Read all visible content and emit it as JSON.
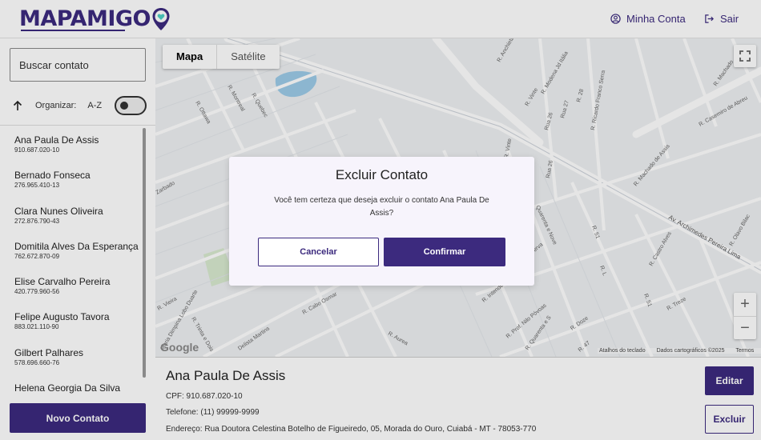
{
  "header": {
    "logo_text": "MAPAMIGO",
    "account_label": "Minha Conta",
    "logout_label": "Sair"
  },
  "sidebar": {
    "search_placeholder": "Buscar contato",
    "sort_label": "Organizar:",
    "sort_value": "A-Z",
    "contacts": [
      {
        "name": "Ana Paula De Assis",
        "cpf": "910.687.020-10"
      },
      {
        "name": "Bernado Fonseca",
        "cpf": "276.965.410-13"
      },
      {
        "name": "Clara Nunes Oliveira",
        "cpf": "272.876.790-43"
      },
      {
        "name": "Domitila Alves Da Esperança",
        "cpf": "762.672.870-09"
      },
      {
        "name": "Elise Carvalho Pereira",
        "cpf": "420.779.960-56"
      },
      {
        "name": "Felipe Augusto Tavora",
        "cpf": "883.021.110-90"
      },
      {
        "name": "Gilbert Palhares",
        "cpf": "578.696.660-76"
      },
      {
        "name": "Helena Georgia Da Silva",
        "cpf": ""
      }
    ],
    "new_contact_label": "Novo Contato"
  },
  "map": {
    "type_map": "Mapa",
    "type_satellite": "Satélite",
    "google": "Google",
    "attrib_shortcuts": "Atalhos do teclado",
    "attrib_data": "Dados cartográficos ©2025",
    "attrib_terms": "Termos",
    "zoom_in": "+",
    "zoom_out": "−",
    "street_labels": [
      "R. Anchieta",
      "R. Modena Jd Itália",
      "R. Ricardo Franco Serra",
      "R. Machado",
      "R. Montreal",
      "R. Quebec",
      "R. Ottawa",
      "R. Vinte",
      "Rua 26",
      "Rua 27",
      "R. 28",
      "R. Casemiro de Abreu",
      "R. Machado de Assis",
      "Av. Archimedes Pereira Lima",
      "R. Olavo Bilac",
      "R. Castro Alves",
      "R. Treze",
      "R. Vinte",
      "Rua 26",
      "R. 51",
      "Quarenta e Nove",
      "Serva",
      "R. L",
      "R. 51",
      "R. Intendente",
      "R. Prof. Nilo Póvoas",
      "R. Quarenta e S",
      "R. Doze",
      "R. 47",
      "R. Vieira",
      "Maria Dimpina Lobo Duarte",
      "R. Trinta e Dois",
      "R. Cabo Osmar",
      "Delista Martins",
      "R. Aurea",
      "Zarbado"
    ]
  },
  "details": {
    "name": "Ana Paula De Assis",
    "cpf_line": "CPF: 910.687.020-10",
    "phone_line": "Telefone: (11) 99999-9999",
    "address_line": "Endereço: Rua Doutora Celestina Botelho de Figueiredo, 05, Morada do Ouro, Cuiabá - MT - 78053-770",
    "edit_label": "Editar",
    "delete_label": "Excluir"
  },
  "modal": {
    "title": "Excluir Contato",
    "message": "Você tem certeza que deseja excluir o contato Ana Paula De Assis?",
    "cancel_label": "Cancelar",
    "confirm_label": "Confirmar"
  },
  "colors": {
    "brand": "#3c2a7e",
    "brand_accent": "#4fd1c5",
    "modal_bg": "#f7f4fc",
    "map_water": "#9ccbe8"
  }
}
